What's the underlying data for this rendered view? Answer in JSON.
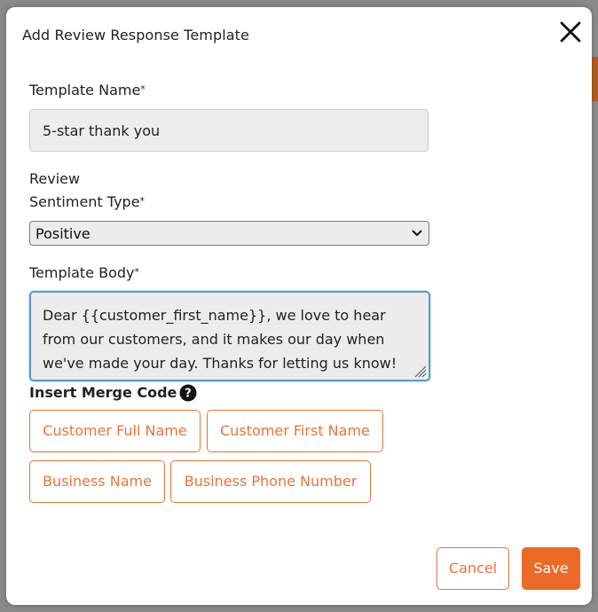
{
  "modal": {
    "title": "Add Review Response Template",
    "close_icon": "close-icon"
  },
  "form": {
    "template_name": {
      "label": "Template Name",
      "required_mark": "*",
      "value": "5-star thank you"
    },
    "sentiment": {
      "label_line1": "Review",
      "label_line2": "Sentiment Type",
      "required_mark": "*",
      "selected": "Positive",
      "icon": "chevron-down-icon"
    },
    "body": {
      "label": "Template Body",
      "required_mark": "*",
      "value": "Dear {{customer_first_name}}, we love to hear from our customers, and it makes our day when we've made your day. Thanks for letting us know!",
      "grip_icon": "resize-grip-icon"
    },
    "merge": {
      "label": "Insert Merge Code",
      "help_icon": "question-circle-icon",
      "codes": [
        "Customer Full Name",
        "Customer First Name",
        "Business Name",
        "Business Phone Number"
      ]
    }
  },
  "actions": {
    "cancel_label": "Cancel",
    "save_label": "Save"
  },
  "colors": {
    "accent": "#e8743b",
    "save_bg": "#ec6a28",
    "focus_border": "#5b9bd5",
    "input_bg": "#ededed",
    "backdrop": "#8a8a8a"
  }
}
